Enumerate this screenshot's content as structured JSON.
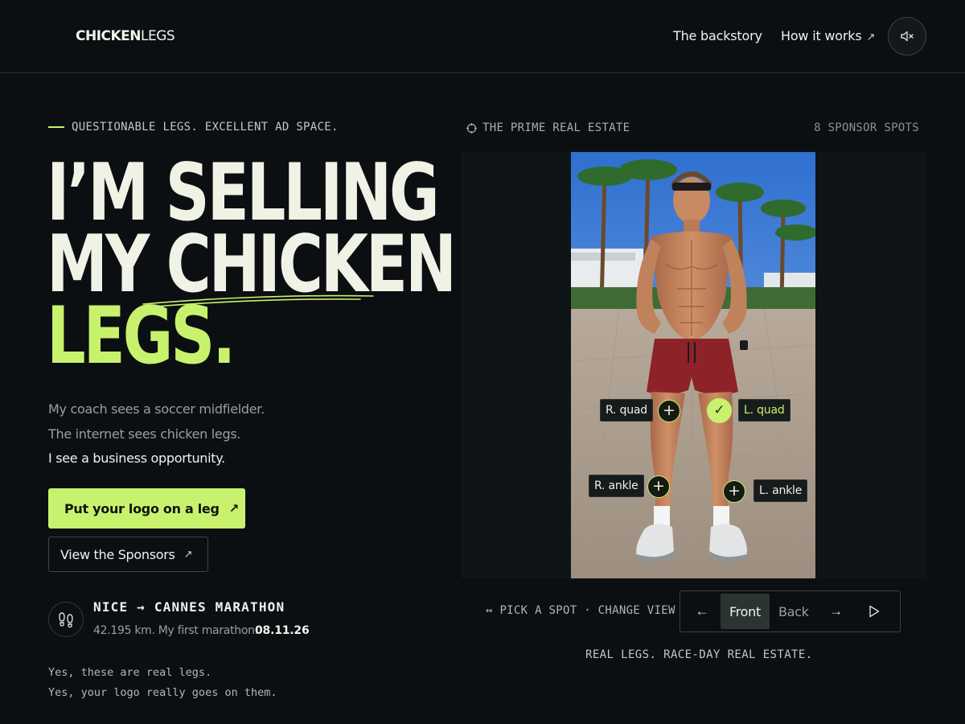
{
  "header": {
    "logo_bold": "CHICKEN",
    "logo_light": "LEGS",
    "nav": [
      {
        "label": "The backstory"
      },
      {
        "label": "How it works",
        "icon": "arrow-up-right-icon"
      }
    ],
    "mute_icon": "speaker-muted-icon"
  },
  "hero": {
    "eyebrow": "QUESTIONABLE LEGS. EXCELLENT AD SPACE.",
    "line1": "I’M SELLING",
    "line2_a": "MY ",
    "line2_b": "CHICKEN",
    "line3": "LEGS.",
    "copy": [
      "My coach sees a soccer midfielder.",
      "The internet sees chicken legs.",
      "I see a business opportunity."
    ],
    "cta_primary": "Put your logo on a leg",
    "cta_secondary": "View the Sponsors"
  },
  "race": {
    "title": "NICE → CANNES MARATHON",
    "subtitle": "42.195 km. My first marathon.",
    "date": "08.11.26",
    "icon": "footprints-icon"
  },
  "note": [
    "Yes, these are real legs.",
    "Yes, your logo really goes on them."
  ],
  "stage": {
    "label": "THE PRIME REAL ESTATE",
    "spots": "8 SPONSOR SPOTS",
    "tags": [
      {
        "label": "R. quad",
        "state": "available"
      },
      {
        "label": "L. quad",
        "state": "selected"
      },
      {
        "label": "R. ankle",
        "state": "available"
      },
      {
        "label": "L. ankle",
        "state": "available"
      }
    ]
  },
  "controls": {
    "hint": "↔ PICK A SPOT · CHANGE VIEW",
    "prev": "←",
    "views": [
      "Front",
      "Back"
    ],
    "active_view": "Front",
    "next": "→",
    "play_icon": "play-icon"
  },
  "tagline": "REAL LEGS. RACE-DAY REAL ESTATE.",
  "colors": {
    "background": "#0b0f12",
    "accent": "#c8f26e",
    "text": "#f1f2e6",
    "muted": "#9aa09a"
  }
}
